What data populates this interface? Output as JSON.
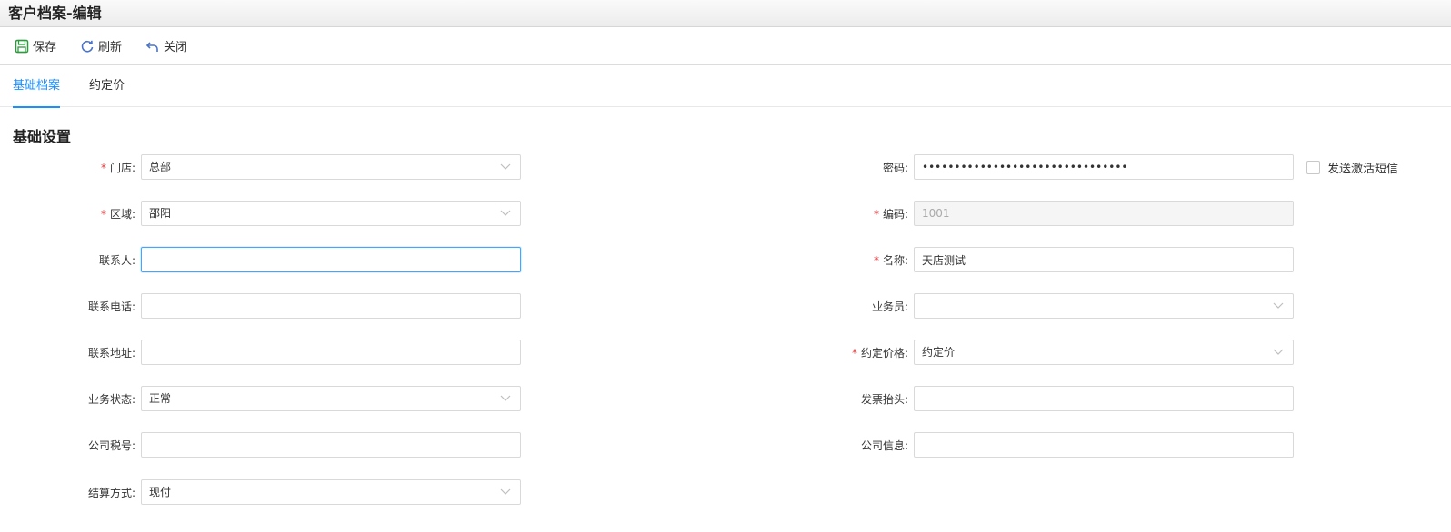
{
  "window": {
    "title": "客户档案-编辑"
  },
  "toolbar": {
    "save": "保存",
    "refresh": "刷新",
    "close": "关闭"
  },
  "tabs": [
    {
      "label": "基础档案"
    },
    {
      "label": "约定价"
    }
  ],
  "section": {
    "title": "基础设置"
  },
  "left": {
    "store": {
      "label": "门店:",
      "value": "总部"
    },
    "region": {
      "label": "区域:",
      "value": "邵阳"
    },
    "contact": {
      "label": "联系人:",
      "value": ""
    },
    "phone": {
      "label": "联系电话:",
      "value": ""
    },
    "address": {
      "label": "联系地址:",
      "value": ""
    },
    "status": {
      "label": "业务状态:",
      "value": "正常"
    },
    "taxno": {
      "label": "公司税号:",
      "value": ""
    },
    "settle": {
      "label": "结算方式:",
      "value": "现付"
    }
  },
  "right": {
    "password": {
      "label": "密码:",
      "value": "••••••••••••••••••••••••••••••••"
    },
    "sms": {
      "label": "发送激活短信"
    },
    "code": {
      "label": "编码:",
      "value": "1001"
    },
    "name": {
      "label": "名称:",
      "value": "天店测试"
    },
    "salesman": {
      "label": "业务员:",
      "value": ""
    },
    "price": {
      "label": "约定价格:",
      "value": "约定价"
    },
    "invoice": {
      "label": "发票抬头:",
      "value": ""
    },
    "info": {
      "label": "公司信息:",
      "value": ""
    }
  },
  "colors": {
    "accent": "#1890ff",
    "required": "#e4393c",
    "save_icon": "#2e9a3e",
    "nav_icon": "#4a73c8"
  },
  "icons": {
    "save": "save-icon",
    "refresh": "refresh-icon",
    "close": "undo-icon",
    "dropdown": "chevron-down-icon"
  }
}
